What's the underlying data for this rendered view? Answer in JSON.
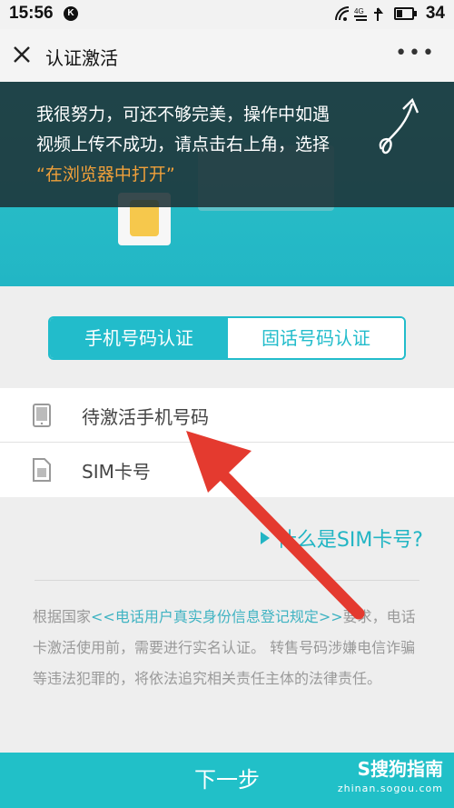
{
  "status_bar": {
    "time": "15:56",
    "k_badge": "K",
    "signal": "4G",
    "battery": "34"
  },
  "titlebar": {
    "title": "认证激活",
    "more": "•••"
  },
  "banner": {
    "line1": "我很努力，可还不够完美，操作中如遇",
    "line2": "视频上传不成功，请点击右上角，选择",
    "line3": "“在浏览器中打开”"
  },
  "tabs": {
    "active": "手机号码认证",
    "inactive": "固话号码认证"
  },
  "form": {
    "phone_label": "待激活手机号码",
    "sim_label": "SIM卡号"
  },
  "sim_link": "什么是SIM卡号?",
  "notice": {
    "prefix": "根据国家",
    "rule": "<<电话用户真实身份信息登记规定>>",
    "suffix": "要求，电话卡激活使用前，需要进行实名认证。 转售号码涉嫌电信诈骗等违法犯罪的，将依法追究相关责任主体的法律责任。"
  },
  "next_button": "下一步",
  "watermark": {
    "logo": "S搜狗指南",
    "url": "zhinan.sogou.com"
  },
  "colors": {
    "accent": "#22bccb",
    "arrow": "#e43a2f",
    "overlay_highlight": "#f0a03a"
  }
}
